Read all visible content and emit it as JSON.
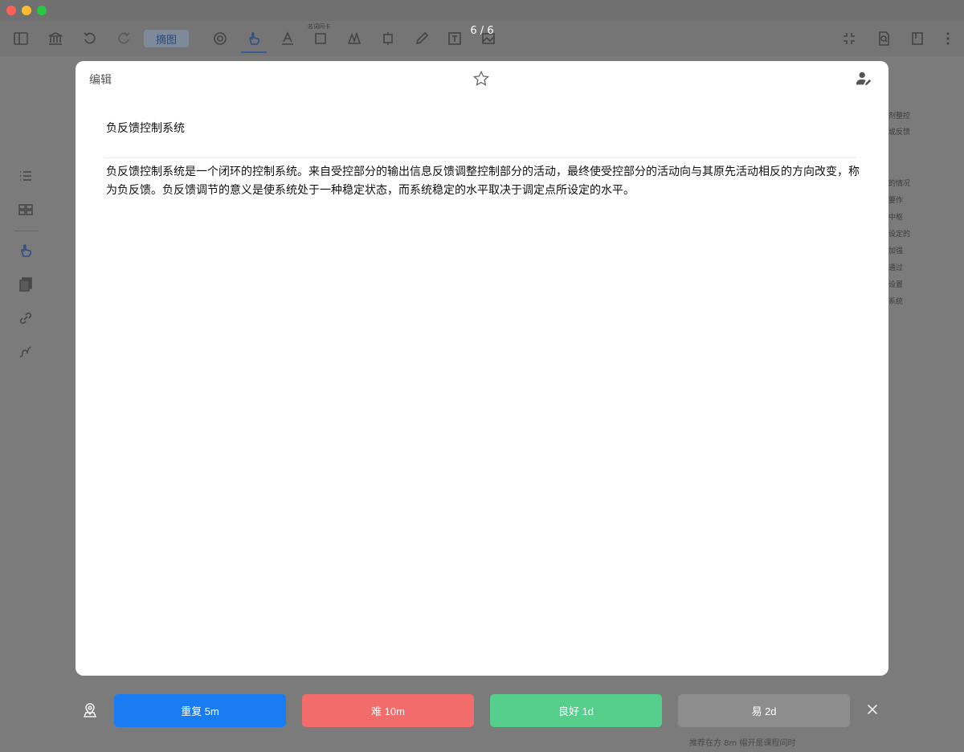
{
  "window": {
    "counter": "6 / 6"
  },
  "toolbar": {
    "mode_label": "摘图",
    "small_label": "名词问卡"
  },
  "background_right_fragments": [
    "剂整控",
    "或反馈",
    "的情况",
    "要作",
    "中枢",
    "设定的",
    "加强",
    "通过",
    "设置",
    "系统"
  ],
  "background_bottom_text": "推荐在方 8m 帽开是课程间时",
  "card": {
    "edit_label": "编辑",
    "front_text": "负反馈控制系统",
    "back_text": "负反馈控制系统是一个闭环的控制系统。来自受控部分的输出信息反馈调整控制部分的活动，最终使受控部分的活动向与其原先活动相反的方向改变，称为负反馈。负反馈调节的意义是使系统处于一种稳定状态，而系统稳定的水平取决于调定点所设定的水平。"
  },
  "answers": {
    "again": "重复 5m",
    "hard": "难 10m",
    "good": "良好 1d",
    "easy": "易 2d"
  },
  "colors": {
    "again": "#1a7cf3",
    "hard": "#f26c6c",
    "good": "#56ce8c",
    "easy": "#8d8d8d"
  }
}
